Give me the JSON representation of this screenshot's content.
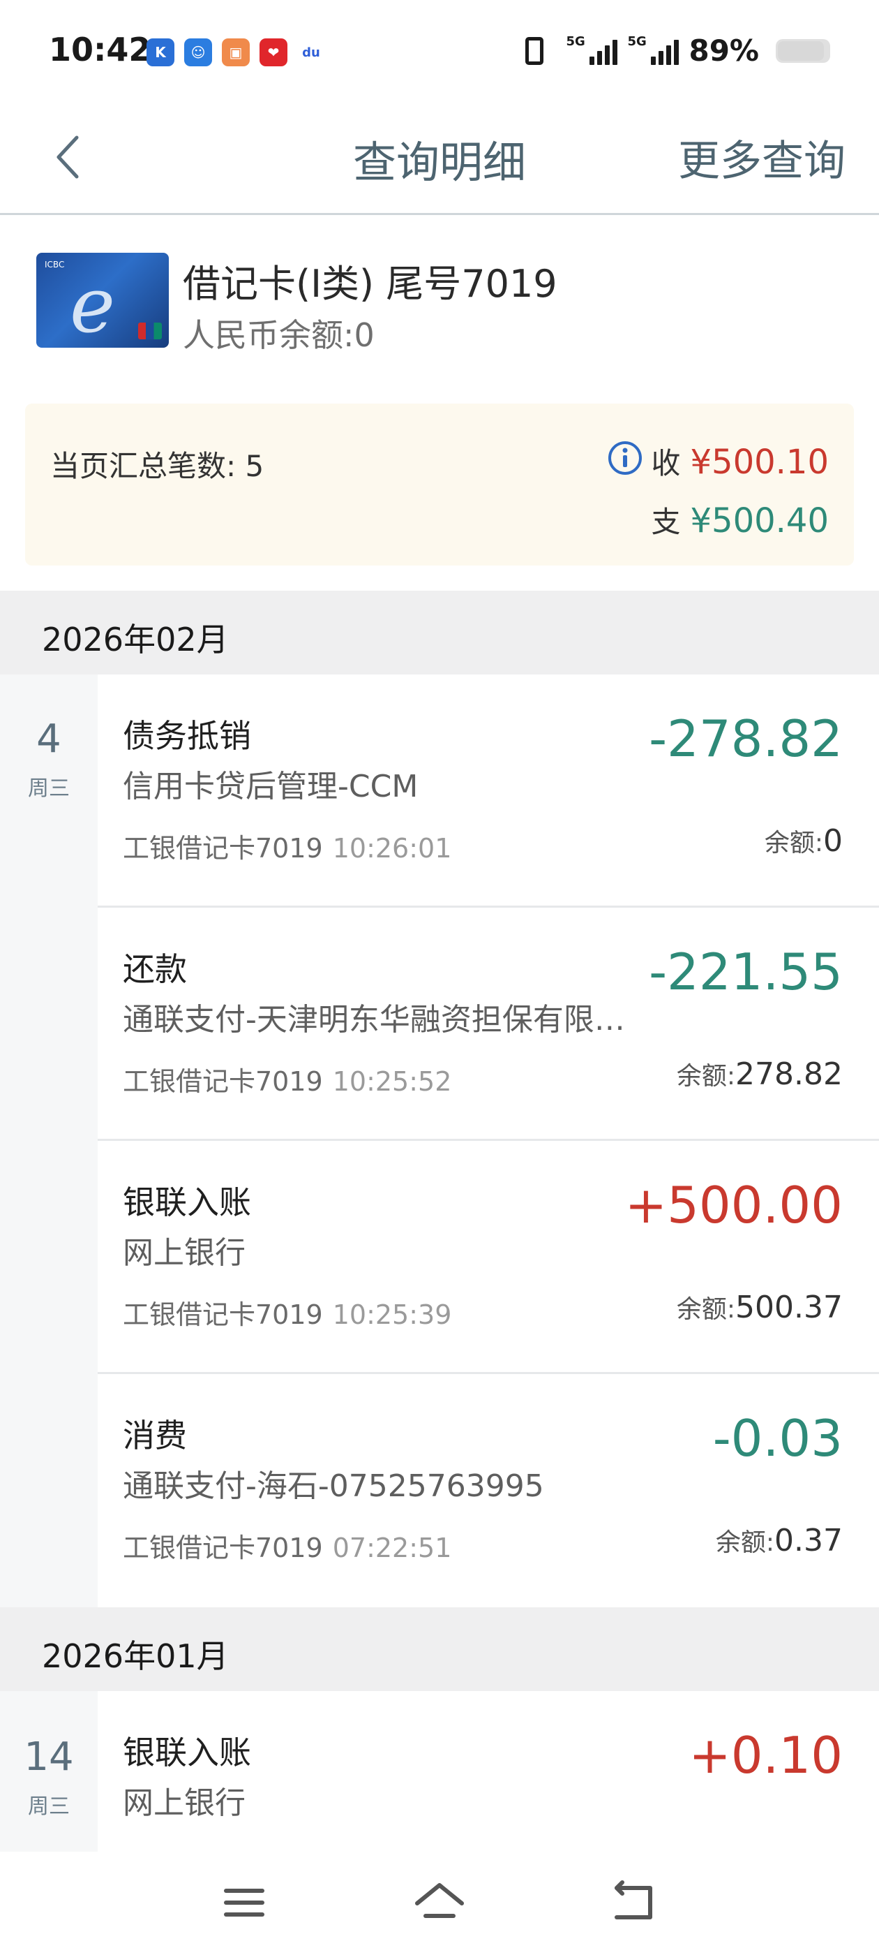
{
  "status": {
    "time": "10:42",
    "signal1_label": "5G",
    "signal2_label": "5G",
    "battery": "89%",
    "apps": [
      {
        "name": "k-app-icon",
        "color": "#2a6fd6",
        "glyph": "K"
      },
      {
        "name": "game-app-icon",
        "color": "#2b7de0",
        "glyph": "☺"
      },
      {
        "name": "orange-app-icon",
        "color": "#f08a4b",
        "glyph": "▣"
      },
      {
        "name": "red-app-icon",
        "color": "#e0262b",
        "glyph": "❤"
      },
      {
        "name": "baidu-app-icon",
        "color": "#ffffff",
        "glyph": "du"
      }
    ]
  },
  "header": {
    "title": "查询明细",
    "more": "更多查询"
  },
  "card": {
    "name": "借记卡(Ⅰ类) 尾号7019",
    "balance": "人民币余额:0"
  },
  "summary": {
    "count": "当页汇总笔数: 5",
    "recv_label": "收",
    "recv_amount": "¥500.10",
    "pay_label": "支",
    "pay_amount": "¥500.40"
  },
  "months": [
    {
      "label": "2026年02月",
      "day": "4",
      "weekday": "周三",
      "transactions": [
        {
          "type": "债务抵销",
          "desc": "信用卡贷后管理-CCM",
          "card": "工银借记卡7019",
          "time": "10:26:01",
          "amount": "-278.82",
          "sign": "neg",
          "balance_label": "余额:",
          "balance": "0"
        },
        {
          "type": "还款",
          "desc": "通联支付-天津明东华融资担保有限…",
          "card": "工银借记卡7019",
          "time": "10:25:52",
          "amount": "-221.55",
          "sign": "neg",
          "balance_label": "余额:",
          "balance": "278.82"
        },
        {
          "type": "银联入账",
          "desc": "网上银行",
          "card": "工银借记卡7019",
          "time": "10:25:39",
          "amount": "+500.00",
          "sign": "pos",
          "balance_label": "余额:",
          "balance": "500.37"
        },
        {
          "type": "消费",
          "desc": "通联支付-海石-07525763995",
          "card": "工银借记卡7019",
          "time": "07:22:51",
          "amount": "-0.03",
          "sign": "neg",
          "balance_label": "余额:",
          "balance": "0.37"
        }
      ]
    },
    {
      "label": "2026年01月",
      "day": "14",
      "weekday": "周三",
      "transactions": [
        {
          "type": "银联入账",
          "desc": "网上银行",
          "amount": "+0.10",
          "sign": "pos"
        }
      ]
    }
  ]
}
